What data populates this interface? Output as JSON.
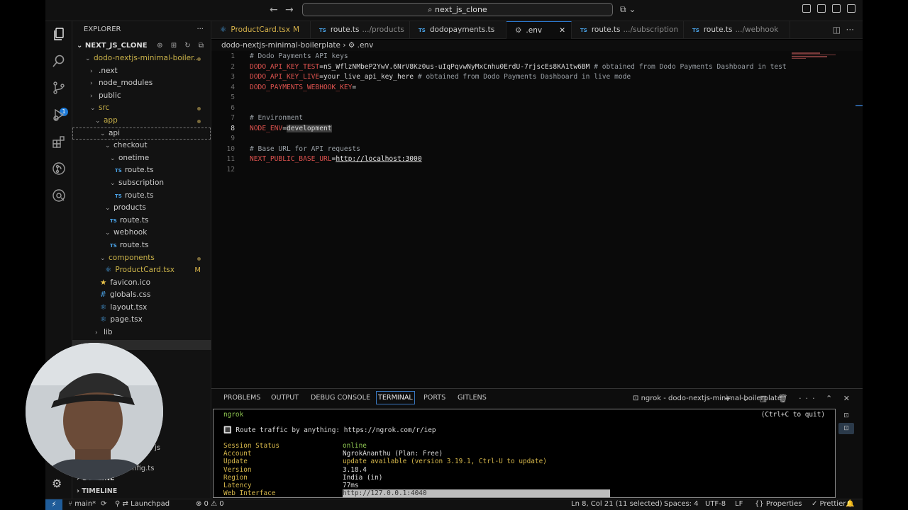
{
  "titlebar": {
    "back": "←",
    "forward": "→",
    "search_text": "next_js_clone",
    "copilot": "⧉ ⌄"
  },
  "activity": {
    "source_control_badge": "1"
  },
  "sidebar": {
    "title": "EXPLORER",
    "more": "···",
    "root": "NEXT_JS_CLONE",
    "tools": "⊕ ⊞ ↻ ⧉",
    "tree": [
      {
        "label": "dodo-nextjs-minimal-boiler...",
        "indent": 0,
        "chev": "⌄",
        "color": "yellow",
        "dot": true
      },
      {
        "label": ".next",
        "indent": 1,
        "chev": "›"
      },
      {
        "label": "node_modules",
        "indent": 1,
        "chev": "›"
      },
      {
        "label": "public",
        "indent": 1,
        "chev": "›"
      },
      {
        "label": "src",
        "indent": 1,
        "chev": "⌄",
        "color": "yellow",
        "dot": true
      },
      {
        "label": "app",
        "indent": 2,
        "chev": "⌄",
        "color": "yellow",
        "dot": true
      },
      {
        "label": "api",
        "indent": 3,
        "chev": "⌄",
        "sel": true
      },
      {
        "label": "checkout",
        "indent": 4,
        "chev": "⌄"
      },
      {
        "label": "onetime",
        "indent": 5,
        "chev": "⌄"
      },
      {
        "label": "route.ts",
        "indent": 6,
        "ts": true
      },
      {
        "label": "subscription",
        "indent": 5,
        "chev": "⌄"
      },
      {
        "label": "route.ts",
        "indent": 6,
        "ts": true
      },
      {
        "label": "products",
        "indent": 4,
        "chev": "⌄"
      },
      {
        "label": "route.ts",
        "indent": 5,
        "ts": true
      },
      {
        "label": "webhook",
        "indent": 4,
        "chev": "⌄"
      },
      {
        "label": "route.ts",
        "indent": 5,
        "ts": true
      },
      {
        "label": "components",
        "indent": 3,
        "chev": "⌄",
        "color": "yellow",
        "dot": true
      },
      {
        "label": "ProductCard.tsx",
        "indent": 4,
        "icon": "⚛",
        "color": "yellow",
        "mod": "M"
      },
      {
        "label": "favicon.ico",
        "indent": 3,
        "icon": "★"
      },
      {
        "label": "globals.css",
        "indent": 3,
        "icon": "#"
      },
      {
        "label": "layout.tsx",
        "indent": 3,
        "icon": "⚛"
      },
      {
        "label": "page.tsx",
        "indent": 3,
        "icon": "⚛"
      },
      {
        "label": "lib",
        "indent": 2,
        "chev": "›"
      }
    ],
    "partial_1": "js",
    "partial_2": "onfig.ts",
    "outline": "OUTLINE",
    "timeline": "TIMELINE"
  },
  "tabs": [
    {
      "label": "ProductCard.tsx",
      "sub": "",
      "mod": "M",
      "icon": "⚛",
      "color": "yellow"
    },
    {
      "label": "route.ts",
      "sub": ".../products",
      "ts": true
    },
    {
      "label": "dodopayments.ts",
      "sub": "",
      "ts": true
    },
    {
      "label": ".env",
      "sub": "",
      "icon": "⚙",
      "active": true,
      "close": "✕"
    },
    {
      "label": "route.ts",
      "sub": ".../subscription",
      "ts": true
    },
    {
      "label": "route.ts",
      "sub": ".../webhook",
      "ts": true
    }
  ],
  "breadcrumb": {
    "folder": "dodo-nextjs-minimal-boilerplate",
    "sep": "›",
    "file": ".env"
  },
  "editor": {
    "current_line": 8,
    "lines": [
      {
        "n": "1",
        "comment": "# Dodo Payments API keys"
      },
      {
        "n": "2",
        "key": "DODO_API_KEY_TEST",
        "value": "nS_WflzNMbeP2YwV.6NrV8Kz0us-uIqPqvwNyMxCnhu0ErdU-7rjscEs8KA1tw6BM",
        "trail": " # obtained from Dodo Payments Dashboard in test"
      },
      {
        "n": "3",
        "key": "DODO_API_KEY_LIVE",
        "value": "your_live_api_key_here",
        "trail": " # obtained from Dodo Payments Dashboard in live mode"
      },
      {
        "n": "4",
        "key": "DODO_PAYMENTS_WEBHOOK_KEY",
        "value": ""
      },
      {
        "n": "5"
      },
      {
        "n": "6"
      },
      {
        "n": "7",
        "comment": "# Environment"
      },
      {
        "n": "8",
        "key": "NODE_ENV",
        "value": "development",
        "highlight": true
      },
      {
        "n": "9"
      },
      {
        "n": "10",
        "comment": "# Base URL for API requests"
      },
      {
        "n": "11",
        "key": "NEXT_PUBLIC_BASE_URL",
        "value": "http://localhost:3000",
        "url": true
      },
      {
        "n": "12"
      }
    ]
  },
  "panel": {
    "tabs": [
      "PROBLEMS",
      "OUTPUT",
      "DEBUG CONSOLE",
      "TERMINAL",
      "PORTS",
      "GITLENS"
    ],
    "active_tab": "TERMINAL",
    "terminal_name": "ngrok - dodo-nextjs-minimal-boilerplate",
    "actions": "+ ⌄ ◫ 🗑 ··· ⌃ ✕",
    "terminal": {
      "app": "ngrok",
      "quit": "(Ctrl+C to quit)",
      "route": "🔳 Route traffic by anything: https://ngrok.com/r/iep",
      "rows": [
        {
          "k": "Session Status",
          "v": "online",
          "vc": "green"
        },
        {
          "k": "Account",
          "v": "NgrokAnanthu (Plan: Free)",
          "vc": "white"
        },
        {
          "k": "Update",
          "v": "update available (version 3.19.1, Ctrl-U to update)",
          "vc": "yellow"
        },
        {
          "k": "Version",
          "v": "3.18.4",
          "vc": "white"
        },
        {
          "k": "Region",
          "v": "India (in)",
          "vc": "white"
        },
        {
          "k": "Latency",
          "v": "77ms",
          "vc": "white"
        },
        {
          "k": "Web Interface",
          "v": "http://127.0.0.1:4040",
          "vc": "white"
        }
      ]
    }
  },
  "statusbar": {
    "remote": "⚡",
    "branch": "main*",
    "sync": "⟳",
    "launchpad": "Launchpad",
    "errors": "⊗ 0 ⚠ 0",
    "position": "Ln 8, Col 21 (11 selected)",
    "spaces": "Spaces: 4",
    "encoding": "UTF-8",
    "eol": "LF",
    "properties": "Properties",
    "prettier": "✓ Prettier",
    "bell": "🔔"
  }
}
